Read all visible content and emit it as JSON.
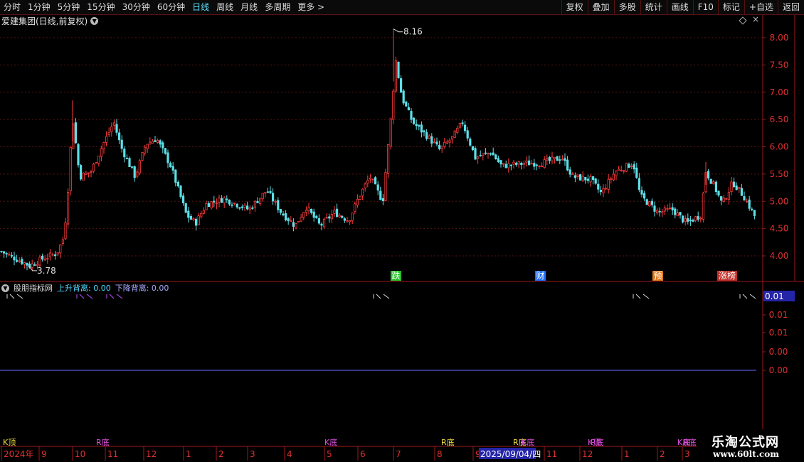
{
  "toolbar": {
    "left_items": [
      "分时",
      "1分钟",
      "5分钟",
      "15分钟",
      "30分钟",
      "60分钟",
      "日线",
      "周线",
      "月线",
      "多周期",
      "更多 >"
    ],
    "active_index": 6,
    "right_items": [
      "复权",
      "叠加",
      "多股",
      "统计",
      "画线",
      "F10",
      "标记",
      "+自选",
      "返回"
    ]
  },
  "chart_title": "爱建集团(日线,前复权)",
  "price_axis": [
    "8.00",
    "7.50",
    "7.00",
    "6.50",
    "6.00",
    "5.50",
    "5.00",
    "4.50",
    "4.00"
  ],
  "annotations": {
    "high": "8.16",
    "low": "3.78"
  },
  "event_badges": [
    {
      "text": "跌",
      "color": "#27c22b",
      "fg": "#fff"
    },
    {
      "text": "财",
      "color": "#1f6fff",
      "fg": "#fff"
    },
    {
      "text": "预",
      "color": "#e07a20",
      "fg": "#fff"
    },
    {
      "text": "涨榜",
      "color": "#c0302a",
      "fg": "#fff"
    }
  ],
  "indicator": {
    "name": "股朋指标网",
    "up_label": "上升背离: 0.00",
    "down_label": "下降背离: 0.00",
    "axis": [
      "0.01",
      "0.01",
      "0.01",
      "0.00",
      "0.00"
    ],
    "current": "0.01"
  },
  "bottom_signals": [
    "K顶",
    "R底",
    "K底",
    "R底",
    "R底",
    "K底",
    "K顶",
    "R底",
    "K底",
    "R底"
  ],
  "timeline": [
    "2024年",
    "9",
    "10",
    "11",
    "12",
    "1",
    "2",
    "3",
    "4",
    "5",
    "6",
    "7",
    "8",
    "9",
    "11",
    "12",
    "1",
    "2",
    "3"
  ],
  "cursor_date": "2025/09/04/四",
  "watermark": {
    "main": "乐淘公式网",
    "url": "www.60lt.com"
  }
}
